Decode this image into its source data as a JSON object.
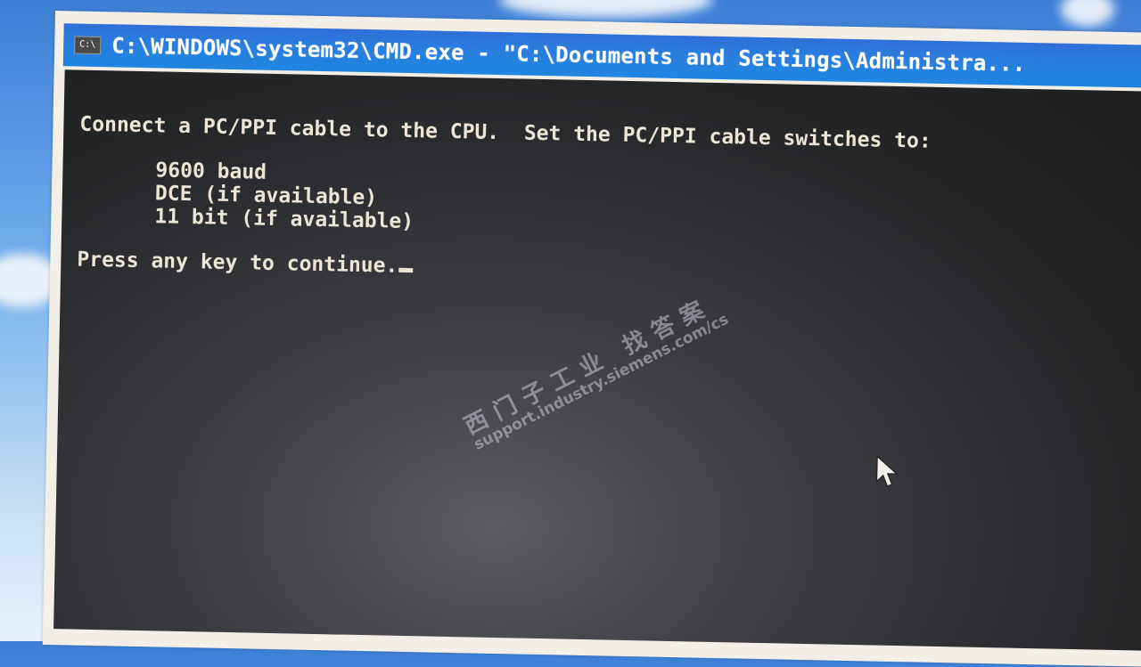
{
  "window": {
    "icon_label": "C:\\",
    "title": "C:\\WINDOWS\\system32\\CMD.exe - \"C:\\Documents and Settings\\Administra..."
  },
  "console": {
    "lines": {
      "l1": "Connect a PC/PPI cable to the CPU.  Set the PC/PPI cable switches to:",
      "l2": "9600 baud",
      "l3": "DCE (if available)",
      "l4": "11 bit (if available)",
      "l5": "Press any key to continue."
    }
  },
  "watermark": {
    "chinese": "西门子工业  找答案",
    "url": "support.industry.siemens.com/cs"
  },
  "colors": {
    "titlebar": "#2a7ddf",
    "console_bg": "#252628",
    "console_text": "#ece4d4"
  }
}
